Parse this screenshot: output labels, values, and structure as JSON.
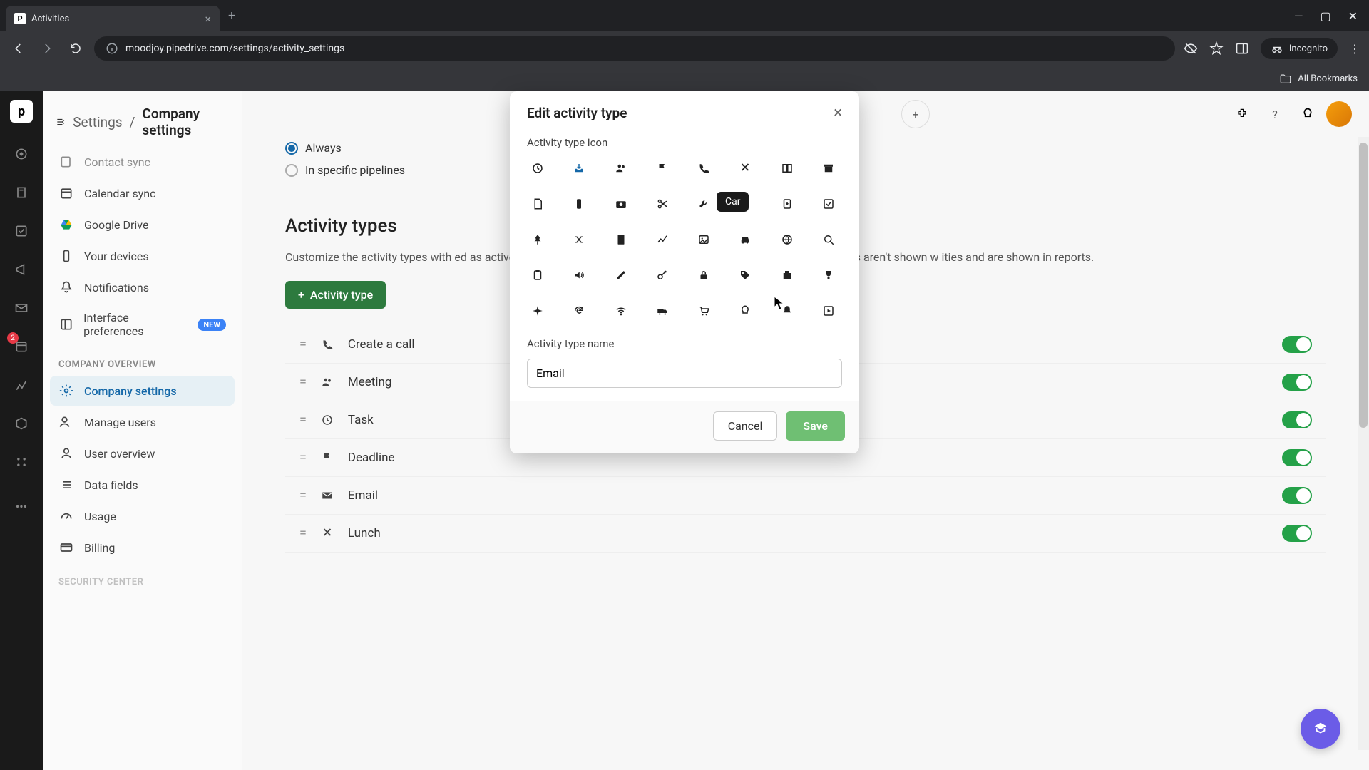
{
  "browser": {
    "tab_title": "Activities",
    "url": "moodjoy.pipedrive.com/settings/activity_settings",
    "incognito_label": "Incognito",
    "bookmarks_label": "All Bookmarks"
  },
  "breadcrumb": {
    "parent": "Settings",
    "current": "Company settings"
  },
  "sidebar": {
    "items_top": [
      {
        "label": "Contact sync",
        "icon": "contact-sync"
      },
      {
        "label": "Calendar sync",
        "icon": "calendar"
      },
      {
        "label": "Google Drive",
        "icon": "gdrive"
      },
      {
        "label": "Your devices",
        "icon": "phone"
      },
      {
        "label": "Notifications",
        "icon": "bell"
      },
      {
        "label": "Interface preferences",
        "icon": "layout",
        "badge": "NEW"
      }
    ],
    "section_label": "COMPANY OVERVIEW",
    "items_company": [
      {
        "label": "Company settings",
        "icon": "gear",
        "active": true
      },
      {
        "label": "Manage users",
        "icon": "users"
      },
      {
        "label": "User overview",
        "icon": "user"
      },
      {
        "label": "Data fields",
        "icon": "list"
      },
      {
        "label": "Usage",
        "icon": "gauge"
      },
      {
        "label": "Billing",
        "icon": "card"
      }
    ],
    "next_section": "SECURITY CENTER"
  },
  "rail": {
    "badge_count": "2"
  },
  "content": {
    "radio_always": "Always",
    "radio_pipelines": "In specific pipelines",
    "section_title": "Activity types",
    "section_desc": "Customize the activity types with                                                                           ed as active are available to all users in your company. Deactivated activity types aren't shown w                                                                         ities and are shown in reports.",
    "add_button": "Activity type",
    "rows": [
      {
        "name": "Create a call",
        "icon": "phone"
      },
      {
        "name": "Meeting",
        "icon": "people"
      },
      {
        "name": "Task",
        "icon": "clock"
      },
      {
        "name": "Deadline",
        "icon": "flag"
      },
      {
        "name": "Email",
        "icon": "mail"
      },
      {
        "name": "Lunch",
        "icon": "utensils"
      }
    ]
  },
  "modal": {
    "title": "Edit activity type",
    "icon_label": "Activity type icon",
    "name_label": "Activity type name",
    "name_value": "Email",
    "cancel": "Cancel",
    "save": "Save",
    "tooltip": "Car",
    "icons": [
      "clock",
      "inbox",
      "people",
      "flag",
      "phone",
      "utensils",
      "book",
      "archive",
      "file",
      "mobile",
      "camera",
      "scissors",
      "wrench",
      "briefcase",
      "clipboard-in",
      "check-square",
      "pin",
      "shuffle",
      "doc",
      "trend",
      "image",
      "car",
      "world",
      "search",
      "clipboard",
      "volume",
      "brush",
      "key",
      "lock",
      "tag",
      "suitcase",
      "trophy",
      "plane",
      "loop",
      "wifi",
      "truck",
      "cart",
      "bulb",
      "bell",
      "play"
    ],
    "selected_icon_index": 1
  }
}
